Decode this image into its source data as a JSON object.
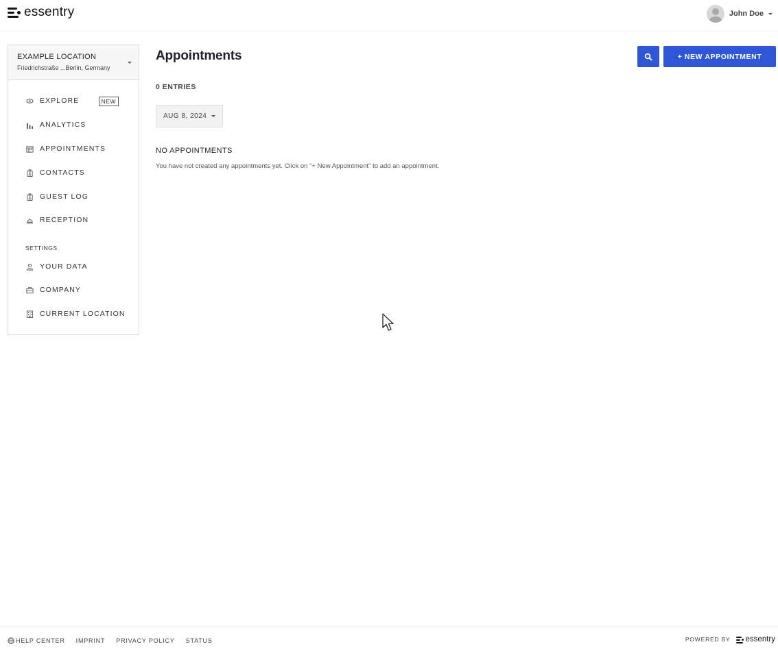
{
  "brand": {
    "name": "essentry"
  },
  "user": {
    "name": "John Doe"
  },
  "location": {
    "name": "EXAMPLE LOCATION",
    "address": "Friedrichstraße ...Berlin, Germany"
  },
  "nav": {
    "items": [
      {
        "label": "EXPLORE",
        "icon": "eye-icon",
        "badge": "NEW"
      },
      {
        "label": "ANALYTICS",
        "icon": "bar-chart-icon"
      },
      {
        "label": "APPOINTMENTS",
        "icon": "calendar-icon"
      },
      {
        "label": "CONTACTS",
        "icon": "badge-icon"
      },
      {
        "label": "GUEST LOG",
        "icon": "badge-icon"
      },
      {
        "label": "RECEPTION",
        "icon": "reception-bell-icon"
      }
    ],
    "settings_label": "SETTINGS",
    "settings_items": [
      {
        "label": "YOUR DATA",
        "icon": "person-icon"
      },
      {
        "label": "COMPANY",
        "icon": "briefcase-icon"
      },
      {
        "label": "CURRENT LOCATION",
        "icon": "building-icon"
      }
    ]
  },
  "main": {
    "title": "Appointments",
    "new_button": "+ NEW APPOINTMENT",
    "entries": "0 ENTRIES",
    "date": "AUG 8, 2024",
    "empty_title": "NO APPOINTMENTS",
    "empty_text": "You have not created any appointments yet. Click on \"+ New Appointment\" to add an appointment."
  },
  "footer": {
    "links": [
      "HELP CENTER",
      "IMPRINT",
      "PRIVACY POLICY",
      "STATUS"
    ],
    "powered_by": "POWERED BY"
  },
  "colors": {
    "primary": "#2e56d6",
    "border": "#dcdcdc"
  }
}
